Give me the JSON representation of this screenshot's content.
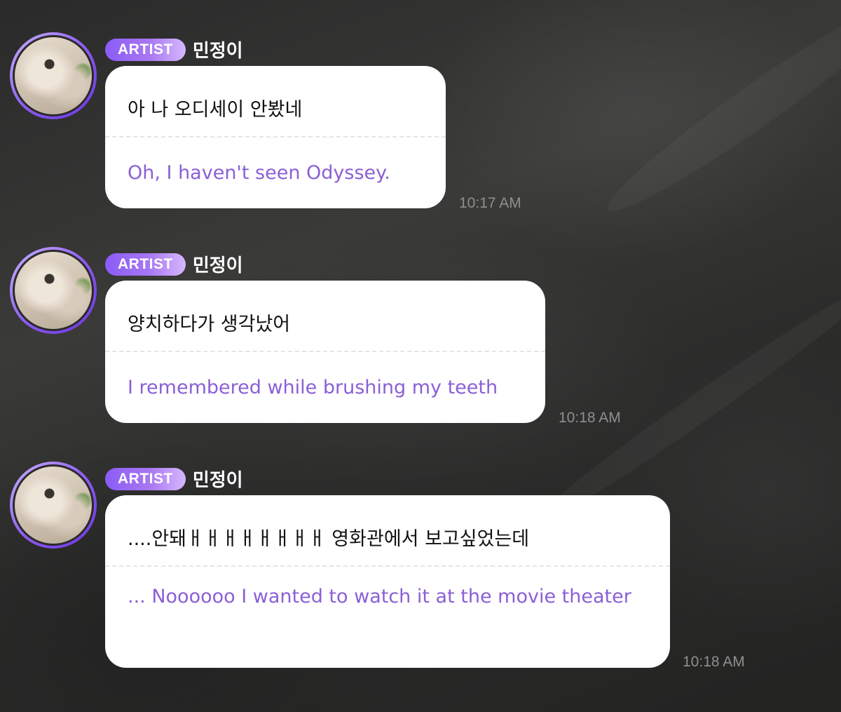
{
  "messages": [
    {
      "badge": "ARTIST",
      "sender": "민정이",
      "original": "아 나 오디세이 안봤네",
      "translation": "Oh, I haven't seen Odyssey.",
      "time": "10:17 AM"
    },
    {
      "badge": "ARTIST",
      "sender": "민정이",
      "original": "양치하다가 생각났어",
      "translation": "I remembered while brushing my teeth",
      "time": "10:18 AM"
    },
    {
      "badge": "ARTIST",
      "sender": "민정이",
      "original": "....안돼ㅐㅐㅐㅐㅐㅐㅐㅐ 영화관에서 보고싶었는데",
      "translation": "... Noooooo I wanted to watch it at the movie theater",
      "time": "10:18 AM"
    }
  ],
  "colors": {
    "badge_gradient_start": "#8a5cf6",
    "badge_gradient_end": "#d6b8ff",
    "translation_text": "#8b5fd6",
    "bubble": "#ffffff",
    "timestamp": "#8f8f8f"
  },
  "icons": [
    "avatar-photo"
  ]
}
